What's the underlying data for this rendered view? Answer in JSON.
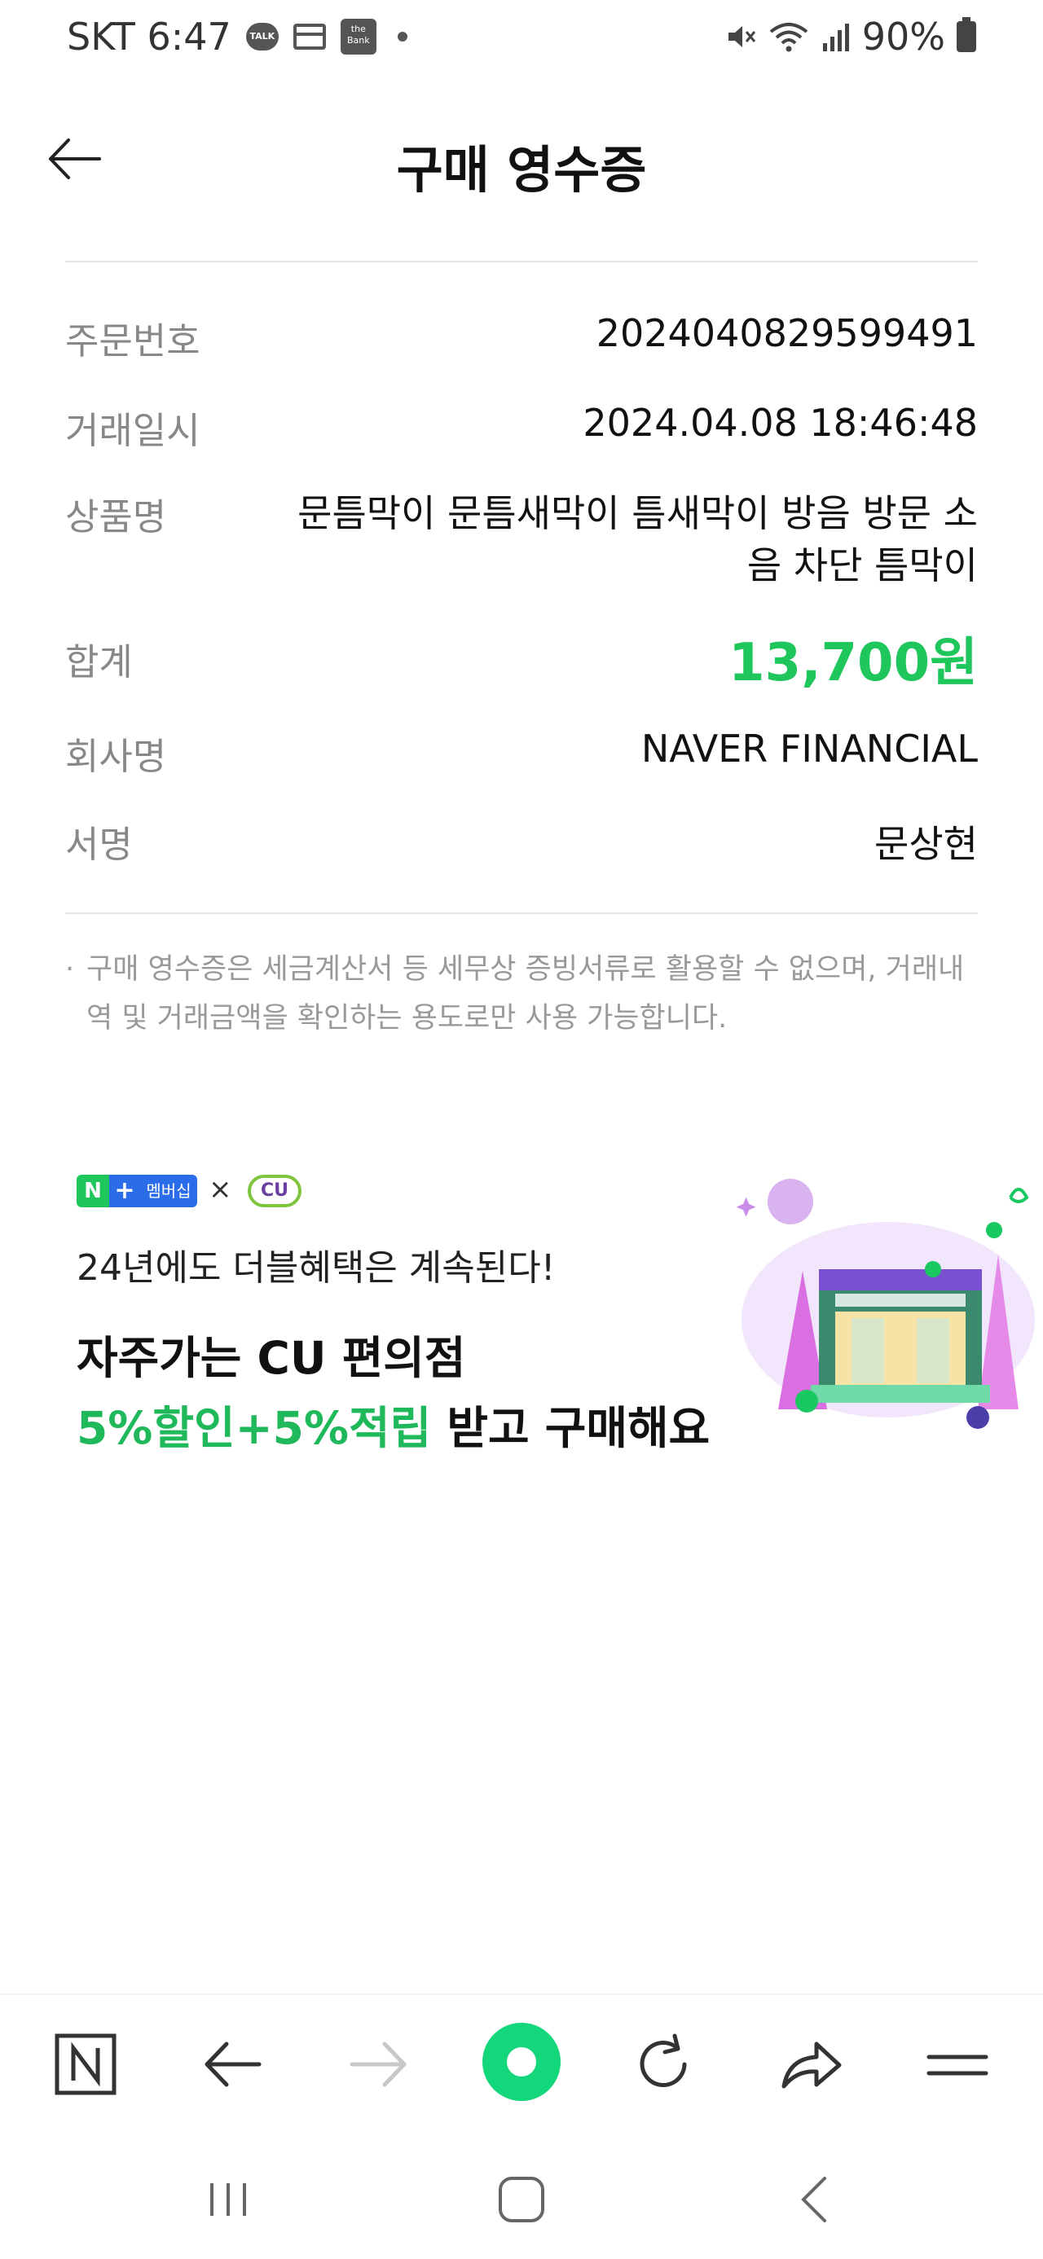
{
  "status_bar": {
    "carrier_time": "SKT 6:47",
    "talk_label": "TALK",
    "bank_label": "the Bank",
    "battery": "90%"
  },
  "header": {
    "title": "구매 영수증"
  },
  "receipt": {
    "order_number": {
      "label": "주문번호",
      "value": "2024040829599491"
    },
    "transaction_date": {
      "label": "거래일시",
      "value": "2024.04.08 18:46:48"
    },
    "product_name": {
      "label": "상품명",
      "value": "문틈막이 문틈새막이 틈새막이 방음 방문 소음 차단 틈막이"
    },
    "total": {
      "label": "합계",
      "value": "13,700원"
    },
    "company": {
      "label": "회사명",
      "value": "NAVER FINANCIAL"
    },
    "signature": {
      "label": "서명",
      "value": "문상현"
    }
  },
  "notice": {
    "bullet": "·",
    "text": "구매 영수증은 세금계산서 등 세무상 증빙서류로 활용할 수 없으며, 거래내역 및 거래금액을 확인하는 용도로만 사용 가능합니다."
  },
  "banner": {
    "badge_n": "N",
    "badge_plus": "+",
    "badge_membership": "멤버십",
    "badge_x": "×",
    "badge_cu": "CU",
    "subtitle": "24년에도 더블혜택은 계속된다!",
    "headline_1": "자주가는 CU 편의점",
    "headline_2_green": "5%할인+5%적립",
    "headline_2_rest": " 받고 구매해요"
  },
  "colors": {
    "accent_green": "#1fc65c",
    "label_gray": "#888888",
    "divider": "#e6e6e6"
  },
  "icons": {
    "back": "arrow-left-icon",
    "naver": "naver-n-icon",
    "browser_back": "arrow-left-icon",
    "browser_forward": "arrow-right-icon",
    "home": "green-circle-home-icon",
    "reload": "reload-icon",
    "share": "share-icon",
    "menu": "menu-icon",
    "recents": "recents-icon",
    "system_home": "system-home-icon",
    "system_back": "system-back-icon"
  }
}
